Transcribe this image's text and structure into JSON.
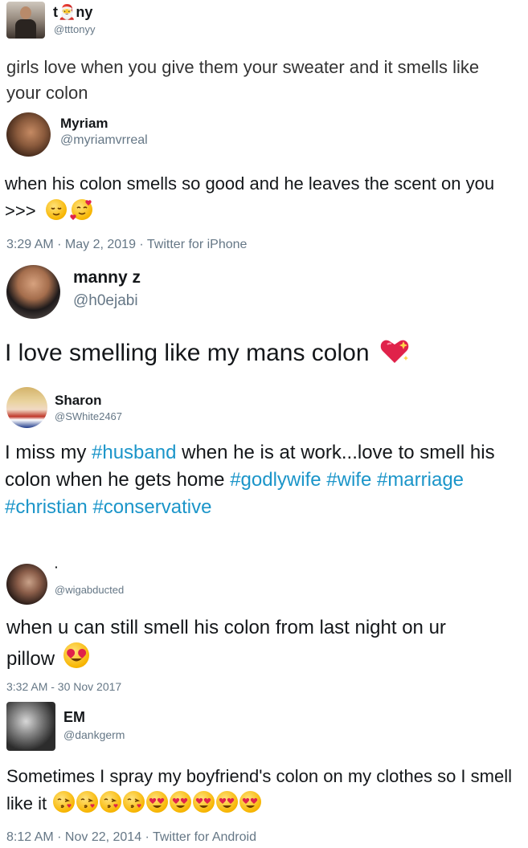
{
  "tweets": [
    {
      "name": "t🎅ny",
      "handle": "@tttonyy",
      "text": "girls love when you give them your sweater and it smells like your colon"
    },
    {
      "name": "Myriam",
      "handle": "@myriamvrreal",
      "text": "when his colon smells so good and he leaves the scent on you >>>",
      "meta": "3:29 AM · May 2, 2019 · Twitter for iPhone",
      "emojis": [
        "relieved-face-icon",
        "smiling-face-with-hearts-icon"
      ]
    },
    {
      "name": "manny z",
      "handle": "@h0ejabi",
      "text": "I love smelling like my mans colon",
      "emojis": [
        "sparkling-heart-icon"
      ]
    },
    {
      "name": "Sharon",
      "handle": "@SWhite2467",
      "text_prefix": "I miss my ",
      "hashtag_1": "#husband",
      "text_middle": " when he is at work...love to smell his colon when he gets home ",
      "hashtags": [
        "#godlywife",
        "#wife",
        "#marriage",
        "#christian",
        "#conservative"
      ]
    },
    {
      "name": "·",
      "handle": "@wigabducted",
      "text": "when u can still smell his colon from last night on ur pillow",
      "meta": "3:32 AM - 30 Nov 2017",
      "emojis": [
        "heart-eyes-face-icon"
      ]
    },
    {
      "name": "EM",
      "handle": "@dankgerm",
      "text": "Sometimes I spray my boyfriend's colon on my clothes so I smell like it",
      "meta": "8:12 AM · Nov 22, 2014 · Twitter for Android",
      "emojis": [
        "face-blowing-kiss-icon",
        "face-blowing-kiss-icon",
        "face-blowing-kiss-icon",
        "face-blowing-kiss-icon",
        "heart-eyes-face-icon",
        "heart-eyes-face-icon",
        "heart-eyes-face-icon",
        "heart-eyes-face-icon",
        "heart-eyes-face-icon"
      ]
    }
  ],
  "colors": {
    "hashtag": "#1b95c9",
    "secondary": "#657786",
    "text": "#14171a"
  }
}
